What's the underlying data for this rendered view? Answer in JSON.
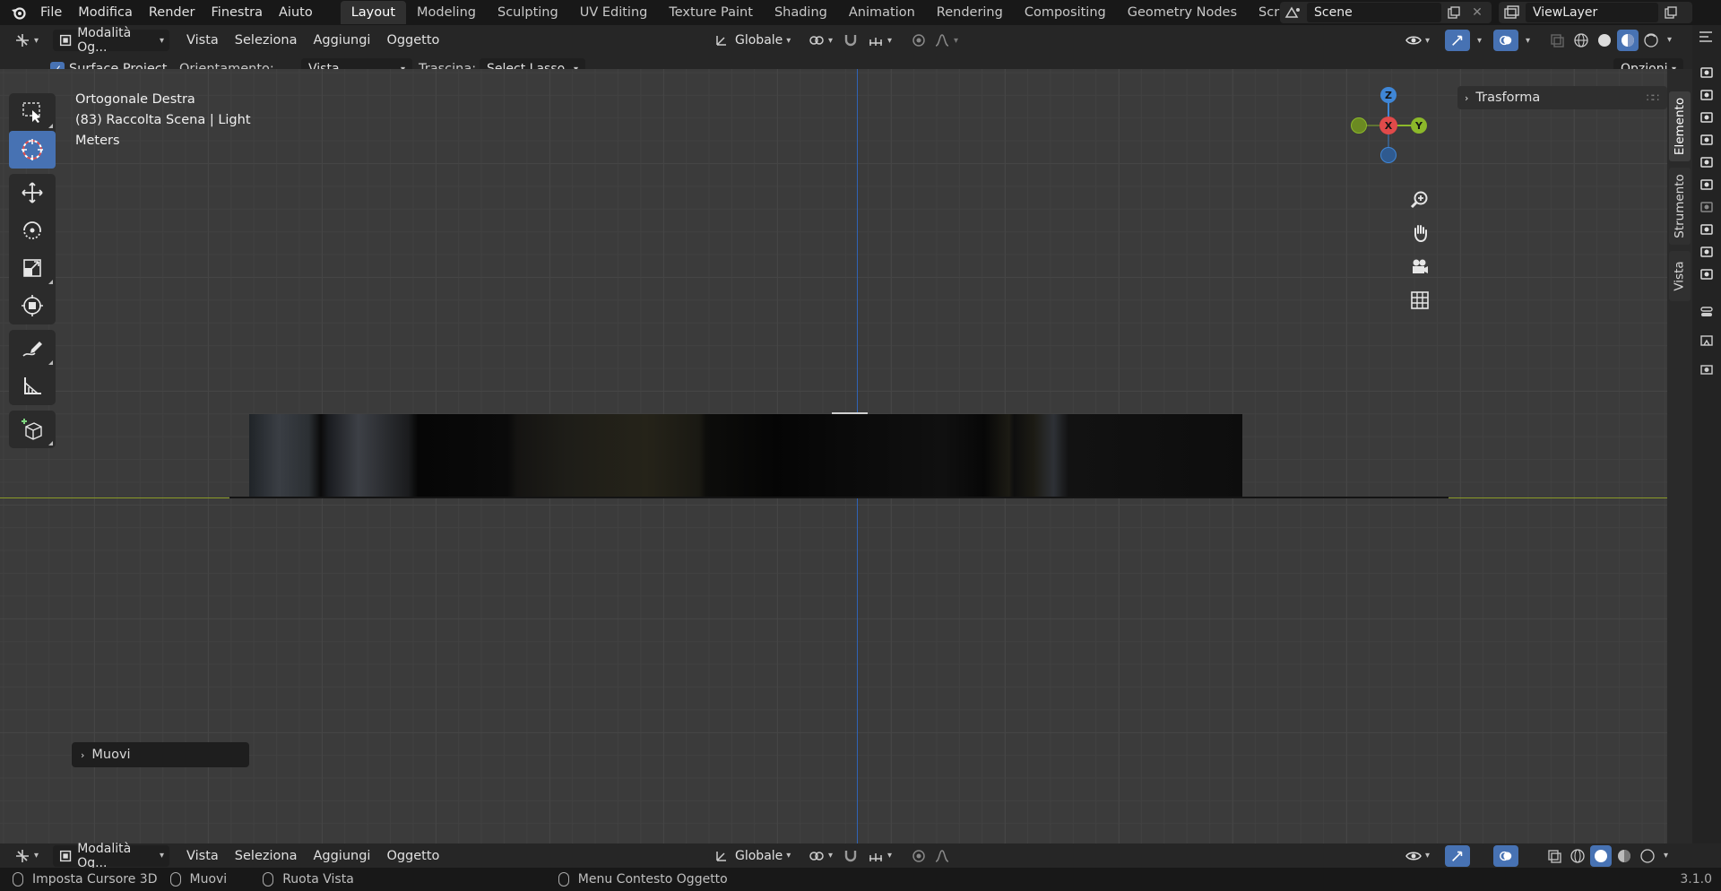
{
  "menu": {
    "items": [
      "File",
      "Modifica",
      "Render",
      "Finestra",
      "Aiuto"
    ]
  },
  "workspaces": {
    "tabs": [
      "Layout",
      "Modeling",
      "Sculpting",
      "UV Editing",
      "Texture Paint",
      "Shading",
      "Animation",
      "Rendering",
      "Compositing",
      "Geometry Nodes",
      "Scripting"
    ],
    "active": "Layout",
    "add_label": "+"
  },
  "scene": {
    "name": "Scene"
  },
  "view_layer": {
    "name": "ViewLayer"
  },
  "header": {
    "mode": "Modalità Og...",
    "menus": [
      "Vista",
      "Seleziona",
      "Aggiungi",
      "Oggetto"
    ],
    "transform_orientation": "Globale"
  },
  "tool_settings": {
    "surface_project_label": "Surface Project",
    "surface_project_checked": true,
    "orientation_label": "Orientamento:",
    "orientation_value": "Vista",
    "drag_label": "Trascina:",
    "drag_value": "Select Lasso",
    "options_label": "Opzioni"
  },
  "viewport": {
    "view_name": "Ortogonale Destra",
    "collection_info": "(83) Raccolta Scena | Light",
    "units": "Meters"
  },
  "gizmo": {
    "z": "Z",
    "x": "X",
    "y": "Y"
  },
  "npanel": {
    "section": "Trasforma",
    "tabs": [
      "Elemento",
      "Strumento",
      "Vista"
    ],
    "active_tab": "Elemento"
  },
  "redo_panel": {
    "label": "Muovi"
  },
  "bottom_header": {
    "mode": "Modalità Og...",
    "menus": [
      "Vista",
      "Seleziona",
      "Aggiungi",
      "Oggetto"
    ],
    "transform_orientation": "Globale"
  },
  "statusbar": {
    "left_click": "Imposta Cursore 3D",
    "middle_click": "Muovi",
    "right_drag": "Ruota Vista",
    "context": "Menu Contesto Oggetto",
    "version": "3.1.0"
  },
  "colors": {
    "accent": "#4772b3",
    "axis_x": "#e04a4a",
    "axis_y": "#8cb82a",
    "axis_z": "#3f86d6"
  }
}
